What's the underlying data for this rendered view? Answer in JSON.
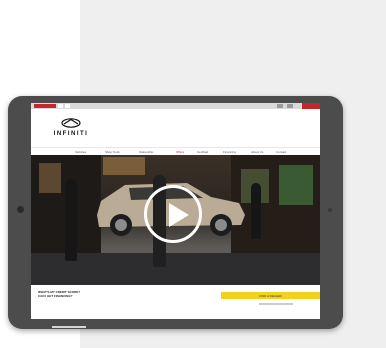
{
  "brand": {
    "name": "INFINITI",
    "accent_color": "#c4262e"
  },
  "nav": {
    "items": [
      "Vehicles",
      "Shop Tools",
      "Ownership",
      "Offers",
      "Certified",
      "Financing",
      "About Us",
      "Contact"
    ]
  },
  "hero": {
    "play_icon": "play-icon",
    "media": "video"
  },
  "promo": {
    "line1": "WHAT'S MY CREDIT SCORE?",
    "line2": "CAN I GET FINANCING?"
  },
  "cta": {
    "label": "FIND A DEALER"
  }
}
